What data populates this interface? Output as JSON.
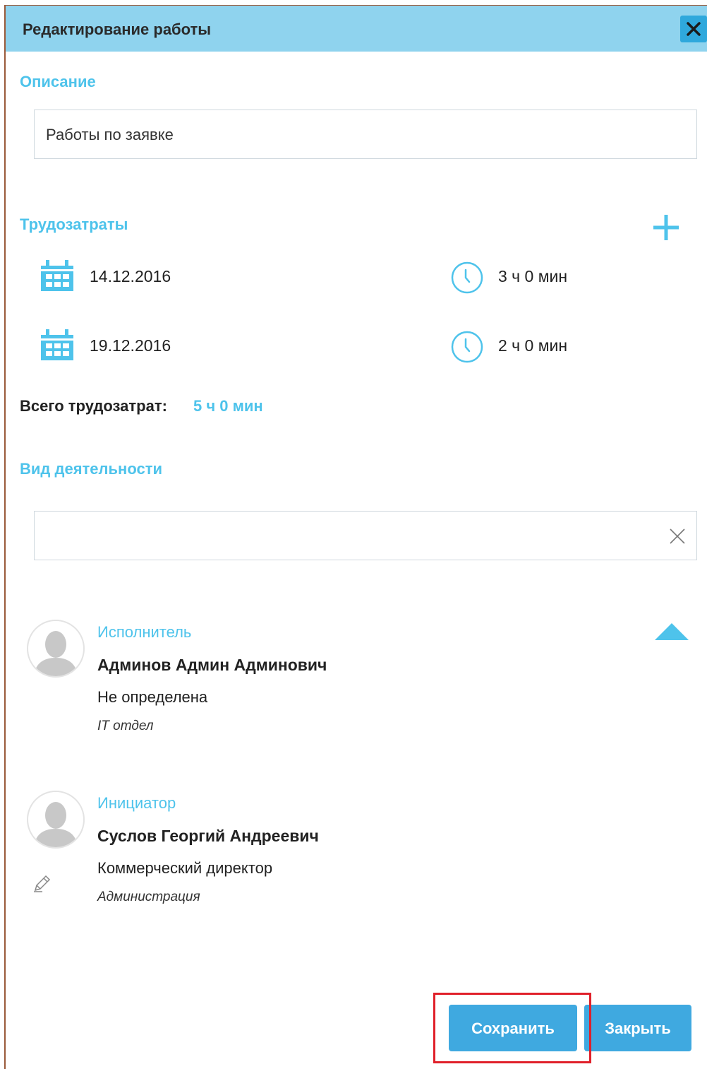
{
  "dialog": {
    "title": "Редактирование работы",
    "close_icon": "close-icon"
  },
  "description": {
    "label": "Описание",
    "value": "Работы по заявке"
  },
  "labor": {
    "label": "Трудозатраты",
    "add_icon": "plus-icon",
    "entries": [
      {
        "date": "14.12.2016",
        "duration": "3 ч 0 мин"
      },
      {
        "date": "19.12.2016",
        "duration": "2 ч 0 мин"
      }
    ],
    "total_label": "Всего трудозатрат:",
    "total_value": "5 ч 0 мин"
  },
  "activity": {
    "label": "Вид деятельности",
    "value": "",
    "clear_icon": "clear-icon"
  },
  "executor": {
    "role": "Исполнитель",
    "name": "Админов Админ Админович",
    "position": "Не определена",
    "department": "IT отдел"
  },
  "initiator": {
    "role": "Инициатор",
    "name": "Суслов Георгий Андреевич",
    "position": "Коммерческий директор",
    "department": "Администрация"
  },
  "buttons": {
    "save": "Сохранить",
    "close": "Закрыть"
  },
  "colors": {
    "accent": "#4ec3eb",
    "titlebar": "#8fd3ee",
    "button": "#3fa9e0",
    "highlight": "#e0202a"
  }
}
